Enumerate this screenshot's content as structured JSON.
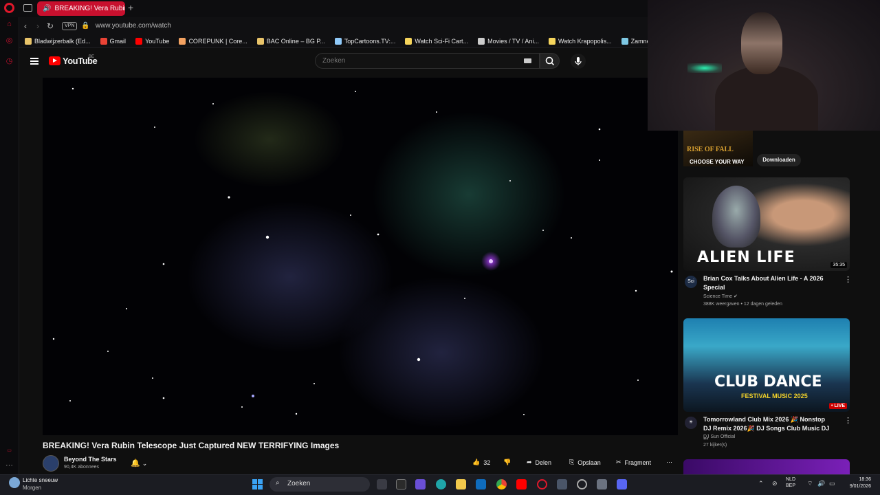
{
  "browser": {
    "active_tab_title": "BREAKING! Vera Rubin",
    "new_tab": "+",
    "vpn_label": "VPN",
    "url": "www.youtube.com/watch",
    "bookmarks": [
      {
        "label": "Bladwijzerbalk (Ed...",
        "color": "#e9c46a"
      },
      {
        "label": "Gmail",
        "color": "#ea4335"
      },
      {
        "label": "YouTube",
        "color": "#ff0000"
      },
      {
        "label": "COREPUNK | Core...",
        "color": "#f4a261"
      },
      {
        "label": "BAC Online – BG P...",
        "color": "#e9c46a"
      },
      {
        "label": "TopCartoons.TV:...",
        "color": "#90caf9"
      },
      {
        "label": "Watch Sci-Fi Cart...",
        "color": "#f6d55c"
      },
      {
        "label": "Movies / TV / Ani...",
        "color": "#cccccc"
      },
      {
        "label": "Watch Krapopolis...",
        "color": "#f6d55c"
      },
      {
        "label": "Zamnesia | Het Be",
        "color": "#7ec8e3"
      }
    ]
  },
  "youtube": {
    "logo_text": "YouTube",
    "region": "BE",
    "search_placeholder": "Zoeken",
    "video_title": "BREAKING! Vera Rubin Telescope Just Captured NEW TERRIFYING Images",
    "channel_name": "Beyond The Stars",
    "channel_subs": "90,4K abonnees",
    "likes": "32",
    "share_label": "Delen",
    "save_label": "Opslaan",
    "clip_label": "Fragment",
    "ad": {
      "line1": "RISE OF FALL",
      "line2": "CHOOSE YOUR WAY",
      "button": "Downloaden"
    },
    "recommendations": [
      {
        "thumb_text": "ALIEN LIFE",
        "duration": "35:35",
        "channel_avatar": "Sci",
        "title": "Brian Cox Talks About Alien Life - A 2026 Special",
        "channel": "Science Time",
        "meta": "388K weergaven • 12 dagen geleden"
      },
      {
        "thumb_text": "CLUB DANCE",
        "thumb_sub": "FESTIVAL MUSIC 2025",
        "badge": "LIVE",
        "title": "Tomorrowland Club Mix 2026 🎉 Nonstop DJ Remix 2026🎉 DJ Songs Club Music DJ ...",
        "channel": "DJ Sun Official",
        "meta": "27 kijker(s)"
      }
    ]
  },
  "taskbar": {
    "weather_line1": "Lichte sneeuw",
    "weather_line2": "Morgen",
    "search_label": "Zoeken",
    "lang_line1": "NLD",
    "lang_line2": "BEP",
    "time": "18:36",
    "date": "9/01/2026"
  },
  "colors": {
    "accent": "#c8102e",
    "youtube_red": "#ff0000",
    "background": "#0f0f0f"
  }
}
